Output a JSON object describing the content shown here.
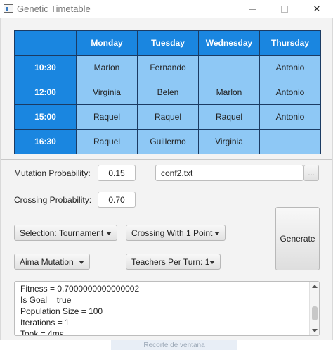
{
  "window": {
    "title": "Genetic Timetable",
    "controls": {
      "minimize": "—",
      "close": "✕"
    }
  },
  "timetable": {
    "days": [
      "Monday",
      "Tuesday",
      "Wednesday",
      "Thursday"
    ],
    "rows": [
      {
        "time": "10:30",
        "cells": [
          "Marlon",
          "Fernando",
          "",
          "Antonio"
        ]
      },
      {
        "time": "12:00",
        "cells": [
          "Virginia",
          "Belen",
          "Marlon",
          "Antonio"
        ]
      },
      {
        "time": "15:00",
        "cells": [
          "Raquel",
          "Raquel",
          "Raquel",
          "Antonio"
        ]
      },
      {
        "time": "16:30",
        "cells": [
          "Raquel",
          "Guillermo",
          "Virginia",
          ""
        ]
      }
    ],
    "colors": {
      "header": "#1a86e0",
      "cell": "#8ec8f5",
      "border": "#1b3b63"
    }
  },
  "form": {
    "mutation_label": "Mutation Probability:",
    "mutation_value": "0.15",
    "crossing_label": "Crossing Probability:",
    "crossing_value": "0.70",
    "file_value": "conf2.txt",
    "browse_label": "...",
    "selection_combo": "Selection: Tournament",
    "crossing_combo": "Crossing With 1 Point",
    "mutation_combo": "Aima Mutation",
    "teachers_combo": "Teachers Per Turn: 1",
    "generate_label": "Generate"
  },
  "log": {
    "lines": [
      "Fitness = 0.7000000000000002",
      "Is Goal = true",
      "Population Size = 100",
      "Iterations = 1",
      "Took = 4ms."
    ]
  },
  "taskbar": {
    "snip_label": "Recorte de ventana"
  }
}
